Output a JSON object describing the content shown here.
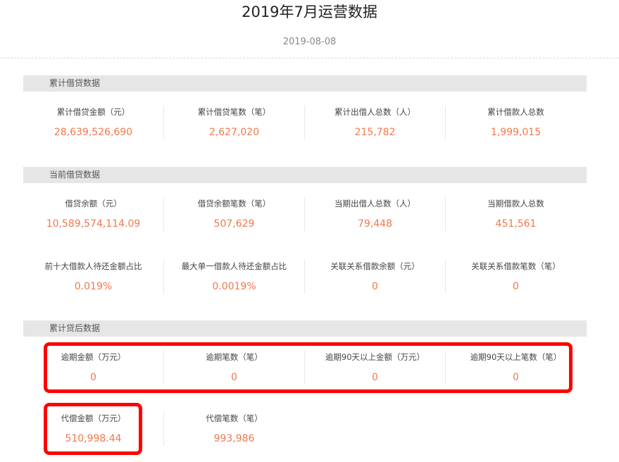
{
  "title": "2019年7月运营数据",
  "date": "2019-08-08",
  "colors": {
    "value": "#f2784b",
    "header_bg": "#e6e6e6",
    "highlight": "#ff0000"
  },
  "sections": [
    {
      "header": "累计借贷数据",
      "rows": [
        [
          {
            "label": "累计借贷金额（元）",
            "value": "28,639,526,690"
          },
          {
            "label": "累计借贷笔数（笔）",
            "value": "2,627,020"
          },
          {
            "label": "累计出借人总数（人）",
            "value": "215,782"
          },
          {
            "label": "累计借款人总数",
            "value": "1,999,015"
          }
        ]
      ]
    },
    {
      "header": "当前借贷数据",
      "rows": [
        [
          {
            "label": "借贷余额（元）",
            "value": "10,589,574,114.09"
          },
          {
            "label": "借贷余额笔数（笔）",
            "value": "507,629"
          },
          {
            "label": "当期出借人总数（人）",
            "value": "79,448"
          },
          {
            "label": "当期借款人总数",
            "value": "451,561"
          }
        ],
        [
          {
            "label": "前十大借款人待还金额占比",
            "value": "0.019%"
          },
          {
            "label": "最大单一借款人待还金额占比",
            "value": "0.0019%"
          },
          {
            "label": "关联关系借款余额（元）",
            "value": "0"
          },
          {
            "label": "关联关系借款笔数（笔）",
            "value": "0"
          }
        ]
      ]
    },
    {
      "header": "累计贷后数据",
      "rows": [
        [
          {
            "label": "逾期金额（万元）",
            "value": "0"
          },
          {
            "label": "逾期笔数（笔）",
            "value": "0"
          },
          {
            "label": "逾期90天以上金额（万元）",
            "value": "0"
          },
          {
            "label": "逾期90天以上笔数（笔）",
            "value": "0"
          }
        ],
        [
          {
            "label": "代偿金额（万元）",
            "value": "510,998.44"
          },
          {
            "label": "代偿笔数（笔）",
            "value": "993,986"
          }
        ]
      ]
    }
  ]
}
